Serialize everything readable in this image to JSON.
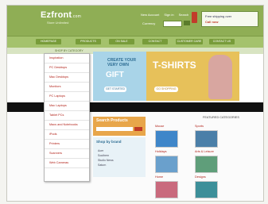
{
  "header": {
    "logo": "Ezfront",
    "logo_suffix": ".com",
    "tagline": "Store Unlimited",
    "links": [
      "New Account",
      "Sign in",
      "Search"
    ],
    "currency_label": "Currency",
    "phone_line1": "Free shipping over",
    "phone_line2": "Call now"
  },
  "nav": {
    "items": [
      "HOMEPAGE",
      "PRODUCTS",
      "ON SALE",
      "CONTACT",
      "CUSTOMER CARE",
      "CONTACT US"
    ]
  },
  "subnav": {
    "text": "SHOP BY CATEGORY"
  },
  "dropdown": {
    "items": [
      "Inspiration",
      "PC Desktops",
      "Mac Desktops",
      "Monitors",
      "PC Laptops",
      "Mac Laptops",
      "Tablet PCs",
      "Macs and Notebooks",
      "iPods",
      "Printers",
      "Scanners",
      "Web Cameras"
    ]
  },
  "banner": {
    "left_line1": "CREATE YOUR VERY OWN",
    "left_line2": "GIFT",
    "left_btn": "GET STARTED",
    "right_title": "T-SHIRTS",
    "right_btn": "GO SHOPPING"
  },
  "search": {
    "title": "Search Products",
    "go": "GO"
  },
  "brand": {
    "title": "Shop by brand",
    "items": [
      "Acer",
      "Southern",
      "Studio News",
      "Saturn"
    ]
  },
  "featured": {
    "title": "FEATURED CATEGORIES",
    "categories": [
      "Mouse",
      "Sports",
      "Holidays",
      "Arts & Leisure",
      "Home",
      "Designs"
    ]
  },
  "colors": {
    "header_green": "#8fae55",
    "nav_green": "#a4c26c",
    "accent_red": "#b2231a",
    "search_orange": "#e8a64a"
  }
}
